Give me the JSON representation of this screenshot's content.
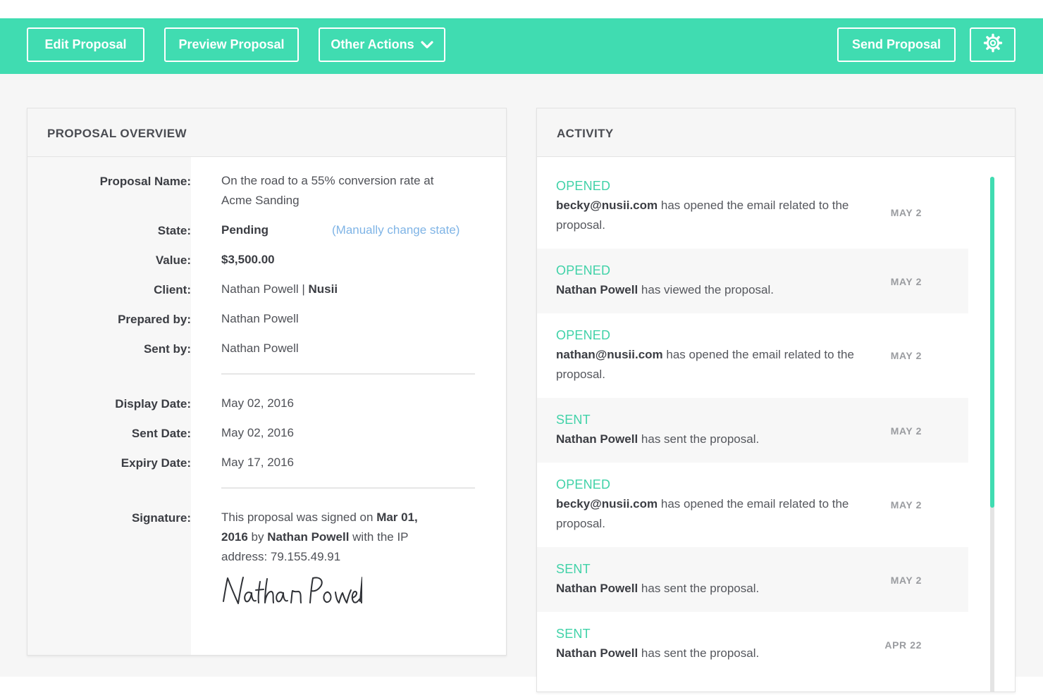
{
  "toolbar": {
    "edit_label": "Edit Proposal",
    "preview_label": "Preview Proposal",
    "other_label": "Other Actions",
    "send_label": "Send Proposal",
    "settings_icon": "gear-icon",
    "other_chevron_icon": "chevron-down-icon",
    "accent_color": "#40dcb1"
  },
  "overview": {
    "title": "PROPOSAL OVERVIEW",
    "proposal_name_label": "Proposal Name:",
    "proposal_name_line1": "On the road to a 55% conversion rate at",
    "proposal_name_line2": "Acme Sanding",
    "state_label": "State:",
    "state_value": "Pending",
    "state_link": "(Manually change state)",
    "value_label": "Value:",
    "value": "$3,500.00",
    "client_label": "Client:",
    "client_name": "Nathan Powell",
    "client_separator": " | ",
    "client_company": "Nusii",
    "prepared_label": "Prepared by:",
    "prepared_value": "Nathan Powell",
    "sentby_label": "Sent by:",
    "sentby_value": "Nathan Powell",
    "display_date_label": "Display Date:",
    "display_date": "May 02, 2016",
    "sent_date_label": "Sent Date:",
    "sent_date": "May 02, 2016",
    "expiry_date_label": "Expiry Date:",
    "expiry_date": "May 17, 2016",
    "signature_label": "Signature:",
    "sig_prefix": "This proposal was signed on ",
    "sig_date_a": "Mar 01,",
    "sig_date_b": "2016",
    "sig_by": " by ",
    "sig_name": "Nathan Powell",
    "sig_ip_a": " with the IP",
    "sig_ip_b": "address: 79.155.49.91",
    "signature_image": "Nathan Powell"
  },
  "activity": {
    "title": "ACTIVITY",
    "items": [
      {
        "type": "OPENED",
        "actor": "becky@nusii.com",
        "line1": " has opened the email related to the",
        "line2": "proposal.",
        "date": "MAY 2"
      },
      {
        "type": "OPENED",
        "actor": "Nathan Powell",
        "line1": " has viewed the proposal.",
        "line2": "",
        "date": "MAY 2"
      },
      {
        "type": "OPENED",
        "actor": "nathan@nusii.com",
        "line1": " has opened the email related to the",
        "line2": "proposal.",
        "date": "MAY 2"
      },
      {
        "type": "SENT",
        "actor": "Nathan Powell",
        "line1": " has sent the proposal.",
        "line2": "",
        "date": "MAY 2"
      },
      {
        "type": "OPENED",
        "actor": "becky@nusii.com",
        "line1": " has opened the email related to the",
        "line2": "proposal.",
        "date": "MAY 2"
      },
      {
        "type": "SENT",
        "actor": "Nathan Powell",
        "line1": " has sent the proposal.",
        "line2": "",
        "date": "MAY 2"
      },
      {
        "type": "SENT",
        "actor": "Nathan Powell",
        "line1": " has sent the proposal.",
        "line2": "",
        "date": "APR 22"
      }
    ]
  }
}
